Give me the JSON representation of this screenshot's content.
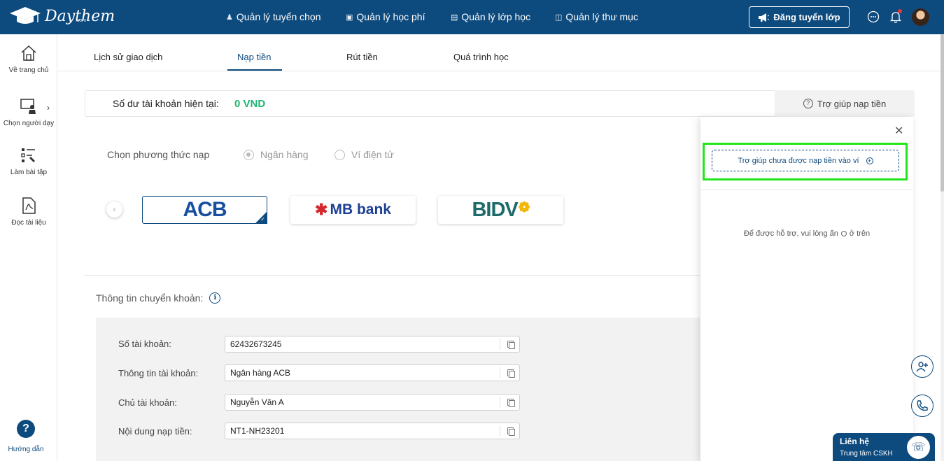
{
  "header": {
    "logo_text": "Daythem",
    "logo_sub": ".com",
    "nav": [
      {
        "label": "Quản lý tuyển chọn",
        "icon": "people-icon"
      },
      {
        "label": "Quản lý học phí",
        "icon": "money-icon"
      },
      {
        "label": "Quản lý lớp học",
        "icon": "board-icon"
      },
      {
        "label": "Quản lý thư mục",
        "icon": "folder-icon"
      }
    ],
    "post_button": "Đăng tuyển lớp"
  },
  "sidebar": {
    "items": [
      {
        "label": "Về trang chủ",
        "icon": "home-icon"
      },
      {
        "label": "Chọn người dạy",
        "icon": "teacher-icon"
      },
      {
        "label": "Làm bài tập",
        "icon": "exercise-icon"
      },
      {
        "label": "Đọc tài liệu",
        "icon": "pdf-icon"
      }
    ],
    "help_label": "Hướng dẫn"
  },
  "tabs": [
    {
      "label": "Lịch sử giao dịch"
    },
    {
      "label": "Nạp tiền"
    },
    {
      "label": "Rút tiền"
    },
    {
      "label": "Quá trình học"
    }
  ],
  "balance": {
    "label": "Số dư tài khoản hiện tại:",
    "value": "0 VND",
    "help_tab": "Trợ giúp nạp tiền"
  },
  "method": {
    "label": "Chọn phương thức nạp",
    "options": [
      "Ngân hàng",
      "Ví điện tử"
    ],
    "selected": "Ngân hàng"
  },
  "banks": [
    {
      "name": "ACB"
    },
    {
      "name": "MB bank"
    },
    {
      "name": "BIDV"
    }
  ],
  "transfer": {
    "title": "Thông tin chuyển khoản:",
    "rows": [
      {
        "label": "Số tài khoản:",
        "value": "62432673245"
      },
      {
        "label": "Thông tin tài khoản:",
        "value": "Ngân hàng ACB"
      },
      {
        "label": "Chủ tài khoản:",
        "value": "Nguyễn Văn A"
      },
      {
        "label": "Nội dung nạp tiền:",
        "value": "NT1-NH23201"
      }
    ]
  },
  "popup": {
    "button": "Trợ giúp chưa được nạp tiền vào ví",
    "hint_before": "Để được hỗ trợ, vui lòng ấn",
    "hint_after": "ở trên"
  },
  "contact": {
    "title": "Liên hệ",
    "subtitle": "Trung tâm CSKH"
  },
  "colors": {
    "primary": "#0d4a7e",
    "balance_green": "#21b573",
    "highlight": "#22e51a"
  }
}
